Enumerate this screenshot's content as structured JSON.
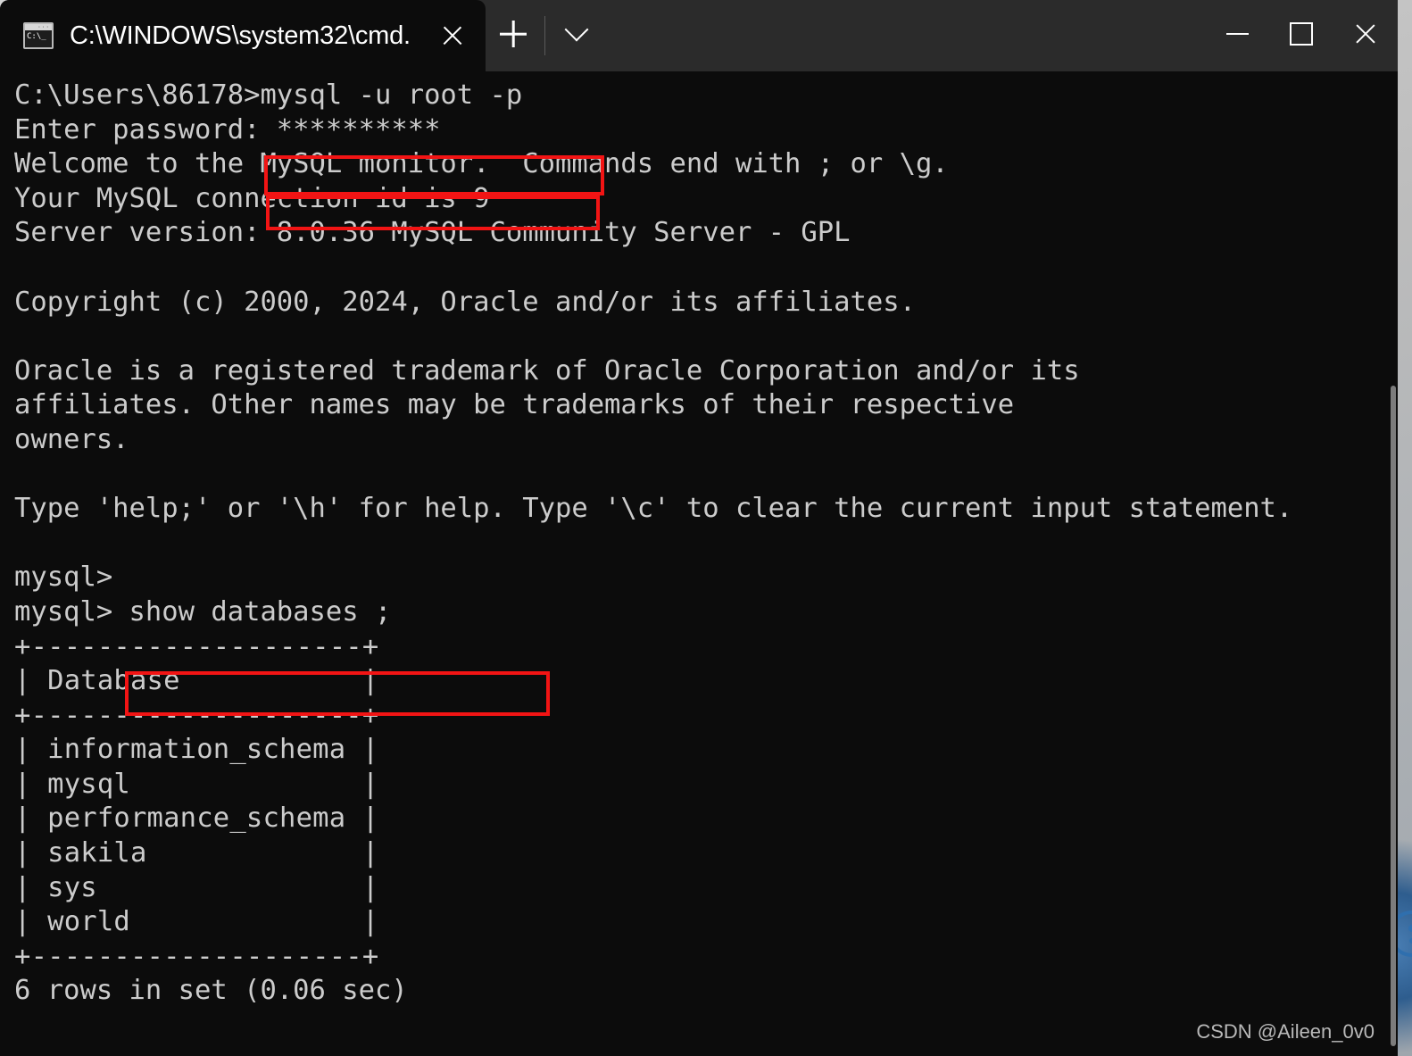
{
  "window": {
    "titlebar_color": "#2b2b2b",
    "terminal_bg": "#0c0c0c",
    "terminal_fg": "#cccccc",
    "highlight_color": "#f21414"
  },
  "tab": {
    "title": "C:\\WINDOWS\\system32\\cmd.",
    "icon_text": "C:\\_",
    "close_icon": "close-icon"
  },
  "tabbar": {
    "new_tab_icon": "plus-icon",
    "dropdown_icon": "chevron-down-icon"
  },
  "window_controls": {
    "minimize": "minimize-icon",
    "maximize": "maximize-icon",
    "close": "close-icon"
  },
  "terminal": {
    "lines": [
      "C:\\Users\\86178>mysql -u root -p",
      "Enter password: **********",
      "Welcome to the MySQL monitor.  Commands end with ; or \\g.",
      "Your MySQL connection id is 9",
      "Server version: 8.0.36 MySQL Community Server - GPL",
      "",
      "Copyright (c) 2000, 2024, Oracle and/or its affiliates.",
      "",
      "Oracle is a registered trademark of Oracle Corporation and/or its",
      "affiliates. Other names may be trademarks of their respective",
      "owners.",
      "",
      "Type 'help;' or '\\h' for help. Type '\\c' to clear the current input statement.",
      "",
      "mysql>",
      "mysql> show databases ;",
      "+--------------------+",
      "| Database           |",
      "+--------------------+",
      "| information_schema |",
      "| mysql              |",
      "| performance_schema |",
      "| sakila             |",
      "| sys                |",
      "| world              |",
      "+--------------------+",
      "6 rows in set (0.06 sec)"
    ],
    "prompt_user": "C:\\Users\\86178>",
    "command_1": "mysql -u root -p",
    "password_mask": "**********",
    "password_label": "Enter password:",
    "mysql_prompt": "mysql>",
    "command_2": "show databases ;",
    "connection_id": "9",
    "server_version": "8.0.36",
    "server_edition": "MySQL Community Server - GPL",
    "copyright_years": "2000, 2024",
    "row_count": "6 rows in set (0.06 sec)",
    "table_header": "Database",
    "table_rows": [
      "information_schema",
      "mysql",
      "performance_schema",
      "sakila",
      "sys",
      "world"
    ]
  },
  "watermark": {
    "text": "CSDN @Aileen_0v0"
  }
}
